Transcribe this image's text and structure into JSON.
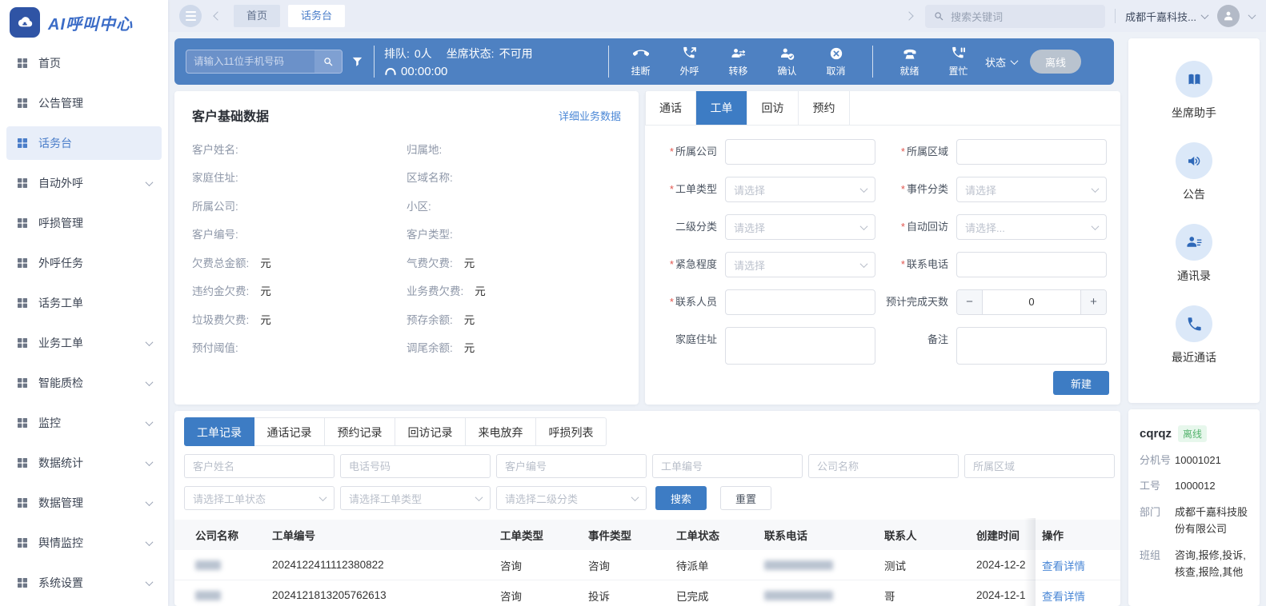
{
  "app": {
    "title": "AI呼叫中心"
  },
  "colors": {
    "accent_blue": "#3d7cc4",
    "callbar_blue": "#4e81c2",
    "logo_blue": "#2f54a5",
    "link_blue": "#4a87d6",
    "badge_green": "#53b36c",
    "page_bg": "#edf1f7"
  },
  "sidebar": {
    "items": [
      {
        "label": "首页",
        "active": false,
        "expandable": false
      },
      {
        "label": "公告管理",
        "active": false,
        "expandable": false
      },
      {
        "label": "话务台",
        "active": true,
        "expandable": false
      },
      {
        "label": "自动外呼",
        "active": false,
        "expandable": true
      },
      {
        "label": "呼损管理",
        "active": false,
        "expandable": false
      },
      {
        "label": "外呼任务",
        "active": false,
        "expandable": false
      },
      {
        "label": "话务工单",
        "active": false,
        "expandable": false
      },
      {
        "label": "业务工单",
        "active": false,
        "expandable": true
      },
      {
        "label": "智能质检",
        "active": false,
        "expandable": true
      },
      {
        "label": "监控",
        "active": false,
        "expandable": true
      },
      {
        "label": "数据统计",
        "active": false,
        "expandable": true
      },
      {
        "label": "数据管理",
        "active": false,
        "expandable": true
      },
      {
        "label": "舆情监控",
        "active": false,
        "expandable": true
      },
      {
        "label": "系统设置",
        "active": false,
        "expandable": true
      }
    ]
  },
  "topbar": {
    "tabs": [
      {
        "label": "首页",
        "active": false
      },
      {
        "label": "话务台",
        "active": true
      }
    ],
    "search_placeholder": "搜索关键词",
    "tenant": "成都千嘉科技..."
  },
  "callbar": {
    "phone_placeholder": "请输入11位手机号码",
    "queue_label": "排队:",
    "queue_value": "0人",
    "seat_label": "坐席状态:",
    "seat_value": "不可用",
    "timer": "00:00:00",
    "button_groups": [
      [
        {
          "label": "挂断",
          "icon": "hangup-icon"
        },
        {
          "label": "外呼",
          "icon": "outbound-call-icon"
        },
        {
          "label": "转移",
          "icon": "transfer-icon"
        },
        {
          "label": "确认",
          "icon": "confirm-icon"
        },
        {
          "label": "取消",
          "icon": "cancel-icon"
        }
      ],
      [
        {
          "label": "就绪",
          "icon": "ready-icon"
        },
        {
          "label": "置忙",
          "icon": "busy-icon"
        }
      ]
    ],
    "status_label": "状态",
    "offline_label": "离线"
  },
  "customer_panel": {
    "title": "客户基础数据",
    "link": "详细业务数据",
    "fields": [
      {
        "label": "客户姓名:",
        "value": ""
      },
      {
        "label": "归属地:",
        "value": ""
      },
      {
        "label": "家庭住址:",
        "value": ""
      },
      {
        "label": "区域名称:",
        "value": ""
      },
      {
        "label": "所属公司:",
        "value": ""
      },
      {
        "label": "小区:",
        "value": ""
      },
      {
        "label": "客户编号:",
        "value": ""
      },
      {
        "label": "客户类型:",
        "value": ""
      },
      {
        "label": "欠费总金额:",
        "value": "元"
      },
      {
        "label": "气费欠费:",
        "value": "元"
      },
      {
        "label": "违约金欠费:",
        "value": "元"
      },
      {
        "label": "业务费欠费:",
        "value": "元"
      },
      {
        "label": "垃圾费欠费:",
        "value": "元"
      },
      {
        "label": "预存余额:",
        "value": "元"
      },
      {
        "label": "预付阈值:",
        "value": ""
      },
      {
        "label": "调尾余额:",
        "value": "元"
      }
    ]
  },
  "ticket_panel": {
    "tabs": [
      {
        "label": "通话",
        "active": false
      },
      {
        "label": "工单",
        "active": true
      },
      {
        "label": "回访",
        "active": false
      },
      {
        "label": "预约",
        "active": false
      }
    ],
    "fields": [
      {
        "required": true,
        "label": "所属公司",
        "type": "input",
        "placeholder": ""
      },
      {
        "required": true,
        "label": "所属区域",
        "type": "input",
        "placeholder": ""
      },
      {
        "required": true,
        "label": "工单类型",
        "type": "select",
        "placeholder": "请选择"
      },
      {
        "required": true,
        "label": "事件分类",
        "type": "select",
        "placeholder": "请选择"
      },
      {
        "required": false,
        "label": "二级分类",
        "type": "select",
        "placeholder": "请选择"
      },
      {
        "required": true,
        "label": "自动回访",
        "type": "select",
        "placeholder": "请选择..."
      },
      {
        "required": true,
        "label": "紧急程度",
        "type": "select",
        "placeholder": "请选择"
      },
      {
        "required": true,
        "label": "联系电话",
        "type": "input",
        "placeholder": ""
      },
      {
        "required": true,
        "label": "联系人员",
        "type": "input",
        "placeholder": ""
      },
      {
        "required": false,
        "label": "预计完成天数",
        "type": "stepper",
        "value": "0"
      },
      {
        "required": false,
        "label": "家庭住址",
        "type": "textarea",
        "placeholder": ""
      },
      {
        "required": false,
        "label": "备注",
        "type": "textarea",
        "placeholder": ""
      }
    ],
    "submit_label": "新建"
  },
  "records_panel": {
    "tabs": [
      {
        "label": "工单记录",
        "active": true
      },
      {
        "label": "通话记录",
        "active": false
      },
      {
        "label": "预约记录",
        "active": false
      },
      {
        "label": "回访记录",
        "active": false
      },
      {
        "label": "来电放弃",
        "active": false
      },
      {
        "label": "呼损列表",
        "active": false
      }
    ],
    "filter_inputs": [
      "客户姓名",
      "电话号码",
      "客户编号",
      "工单编号",
      "公司名称",
      "所属区域"
    ],
    "filter_selects": [
      "请选择工单状态",
      "请选择工单类型",
      "请选择二级分类"
    ],
    "search_label": "搜索",
    "reset_label": "重置",
    "table": {
      "headers": [
        "公司名称",
        "工单编号",
        "工单类型",
        "事件类型",
        "工单状态",
        "联系电话",
        "联系人",
        "创建时间",
        "操作"
      ],
      "rows": [
        {
          "company": "",
          "company_redacted": true,
          "ticket_no": "2024122411112380822",
          "ticket_type": "咨询",
          "event_type": "咨询",
          "status": "待派单",
          "phone": "",
          "phone_redacted": true,
          "contact": "测试",
          "created": "2024-12-2",
          "action": "查看详情"
        },
        {
          "company": "",
          "company_redacted": true,
          "ticket_no": "2024121813205762613",
          "ticket_type": "咨询",
          "event_type": "投诉",
          "status": "已完成",
          "phone": "",
          "phone_redacted": true,
          "contact": "哥",
          "created": "2024-12-1",
          "action": "查看详情"
        }
      ]
    }
  },
  "right_rail": {
    "items": [
      {
        "label": "坐席助手",
        "icon": "agent-assist-book-icon"
      },
      {
        "label": "公告",
        "icon": "announcement-speaker-icon"
      },
      {
        "label": "通讯录",
        "icon": "contacts-icon"
      },
      {
        "label": "最近通话",
        "icon": "recent-calls-icon"
      }
    ]
  },
  "agent_panel": {
    "name": "cqrqz",
    "status": "离线",
    "rows": [
      {
        "label": "分机号",
        "value": "10001021"
      },
      {
        "label": "工号",
        "value": "1000012"
      },
      {
        "label": "部门",
        "value": "成都千嘉科技股份有限公司"
      },
      {
        "label": "班组",
        "value": "咨询,报修,投诉,核查,报险,其他"
      }
    ]
  }
}
